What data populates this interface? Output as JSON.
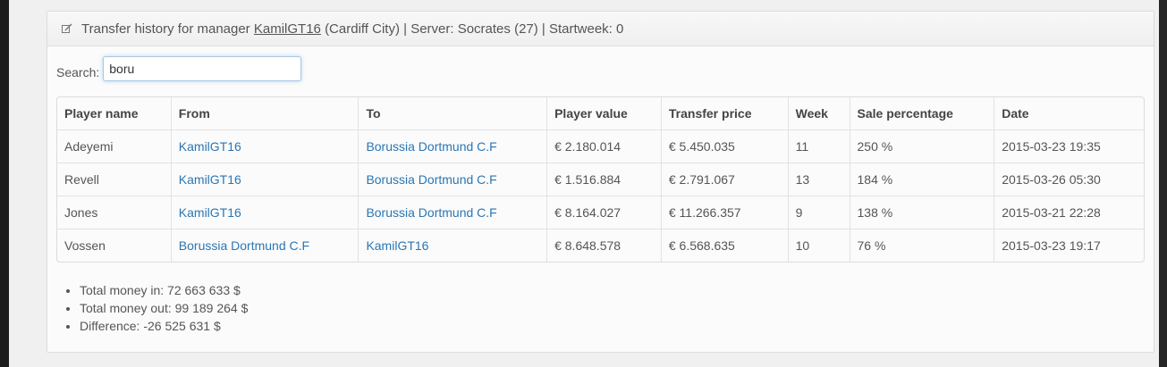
{
  "header": {
    "prefix": "Transfer history for manager",
    "manager": "KamilGT16",
    "suffix": "(Cardiff City) | Server: Socrates (27) | Startweek: 0"
  },
  "search": {
    "label": "Search:",
    "value": "boru"
  },
  "table": {
    "columns": [
      "Player name",
      "From",
      "To",
      "Player value",
      "Transfer price",
      "Week",
      "Sale percentage",
      "Date"
    ],
    "rows": [
      [
        "Adeyemi",
        "KamilGT16",
        "Borussia Dortmund C.F",
        "€ 2.180.014",
        "€ 5.450.035",
        "11",
        "250 %",
        "2015-03-23 19:35"
      ],
      [
        "Revell",
        "KamilGT16",
        "Borussia Dortmund C.F",
        "€ 1.516.884",
        "€ 2.791.067",
        "13",
        "184 %",
        "2015-03-26 05:30"
      ],
      [
        "Jones",
        "KamilGT16",
        "Borussia Dortmund C.F",
        "€ 8.164.027",
        "€ 11.266.357",
        "9",
        "138 %",
        "2015-03-21 22:28"
      ],
      [
        "Vossen",
        "Borussia Dortmund C.F",
        "KamilGT16",
        "€ 8.648.578",
        "€ 6.568.635",
        "10",
        "76 %",
        "2015-03-23 19:17"
      ]
    ]
  },
  "summary": [
    "Total money in: 72 663 633 $",
    "Total money out: 99 189 264 $",
    "Difference: -26 525 631 $"
  ],
  "icons": {
    "header": "edit-icon"
  },
  "colors": {
    "link": "#2a76b5",
    "text": "#555555"
  }
}
